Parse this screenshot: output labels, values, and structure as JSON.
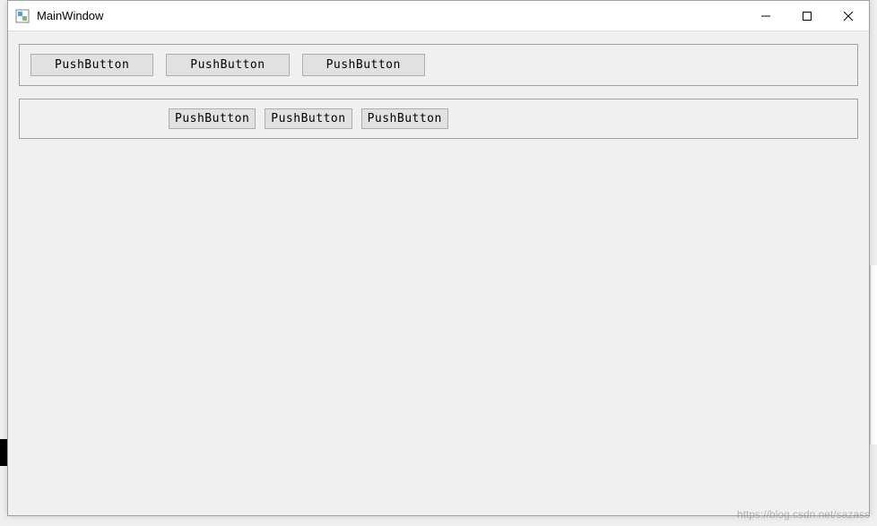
{
  "window": {
    "title": "MainWindow"
  },
  "groupbox1": {
    "buttons": [
      {
        "label": "PushButton"
      },
      {
        "label": "PushButton"
      },
      {
        "label": "PushButton"
      }
    ]
  },
  "groupbox2": {
    "buttons": [
      {
        "label": "PushButton"
      },
      {
        "label": "PushButton"
      },
      {
        "label": "PushButton"
      }
    ]
  },
  "watermark": "https://blog.csdn.net/sazass"
}
